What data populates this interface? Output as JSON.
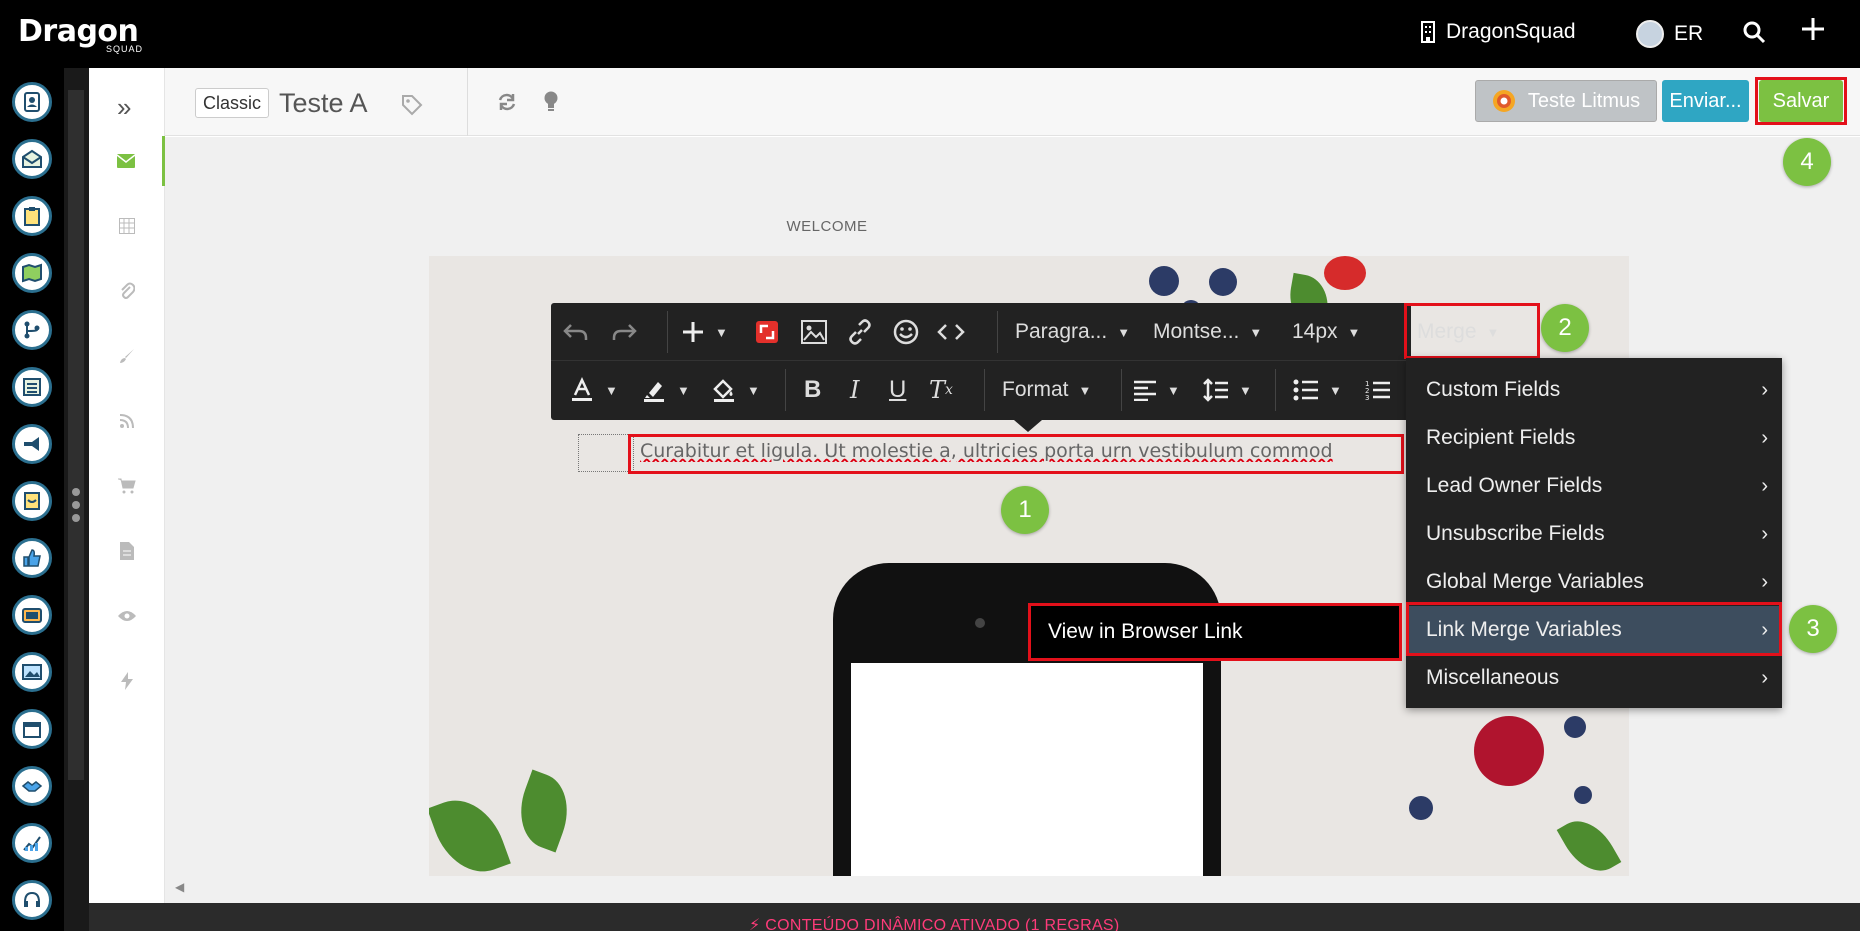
{
  "topbar": {
    "logo_text": "Dragon",
    "logo_sub": "SQUAD",
    "org_name": "DragonSquad",
    "user_initials": "ER"
  },
  "header": {
    "mode_badge": "Classic",
    "title": "Teste A",
    "litmus_label": "Teste Litmus",
    "send_label": "Enviar...",
    "save_label": "Salvar"
  },
  "canvas": {
    "section_label": "WELCOME",
    "body_text": "Curabitur et ligula. Ut molestie a, ultricies porta urn vestibulum commod"
  },
  "toolbar": {
    "paragraph_label": "Paragra...",
    "font_label": "Montse...",
    "size_label": "14px",
    "merge_label": "Merge",
    "format_label": "Format"
  },
  "merge_menu": {
    "items": [
      {
        "label": "Custom Fields"
      },
      {
        "label": "Recipient Fields"
      },
      {
        "label": "Lead Owner Fields"
      },
      {
        "label": "Unsubscribe Fields"
      },
      {
        "label": "Global Merge Variables"
      },
      {
        "label": "Link Merge Variables"
      },
      {
        "label": "Miscellaneous"
      }
    ],
    "submenu_item": "View in Browser Link"
  },
  "steps": {
    "one": "1",
    "two": "2",
    "three": "3",
    "four": "4"
  },
  "footer": {
    "dynamic_content": "⚡ CONTEÚDO DINÂMICO ATIVADO (1 REGRAS)"
  },
  "colors": {
    "accent_green": "#7cc142",
    "accent_blue": "#2fa6c3",
    "highlight_red": "#e3101a",
    "dynamic_pink": "#ff3b7a"
  }
}
